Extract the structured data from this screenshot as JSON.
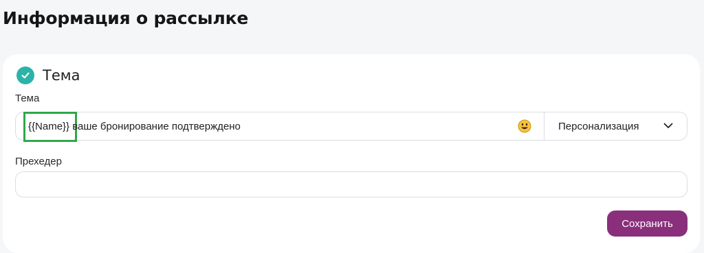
{
  "page": {
    "title": "Информация о рассылке"
  },
  "section": {
    "title": "Тема",
    "status_icon": "check-circle-icon",
    "accent": "#2bb3a9"
  },
  "subject": {
    "label": "Тема",
    "value": "{{Name}} ваше бронирование подтверждено",
    "emoji_icon": "smiley-icon",
    "highlight_color": "#2ea84a"
  },
  "personalization": {
    "label": "Персонализация",
    "icon": "chevron-down-icon"
  },
  "preheader": {
    "label": "Прехедер",
    "value": "",
    "placeholder": ""
  },
  "actions": {
    "save_label": "Сохранить",
    "save_color": "#8a2f7c"
  }
}
